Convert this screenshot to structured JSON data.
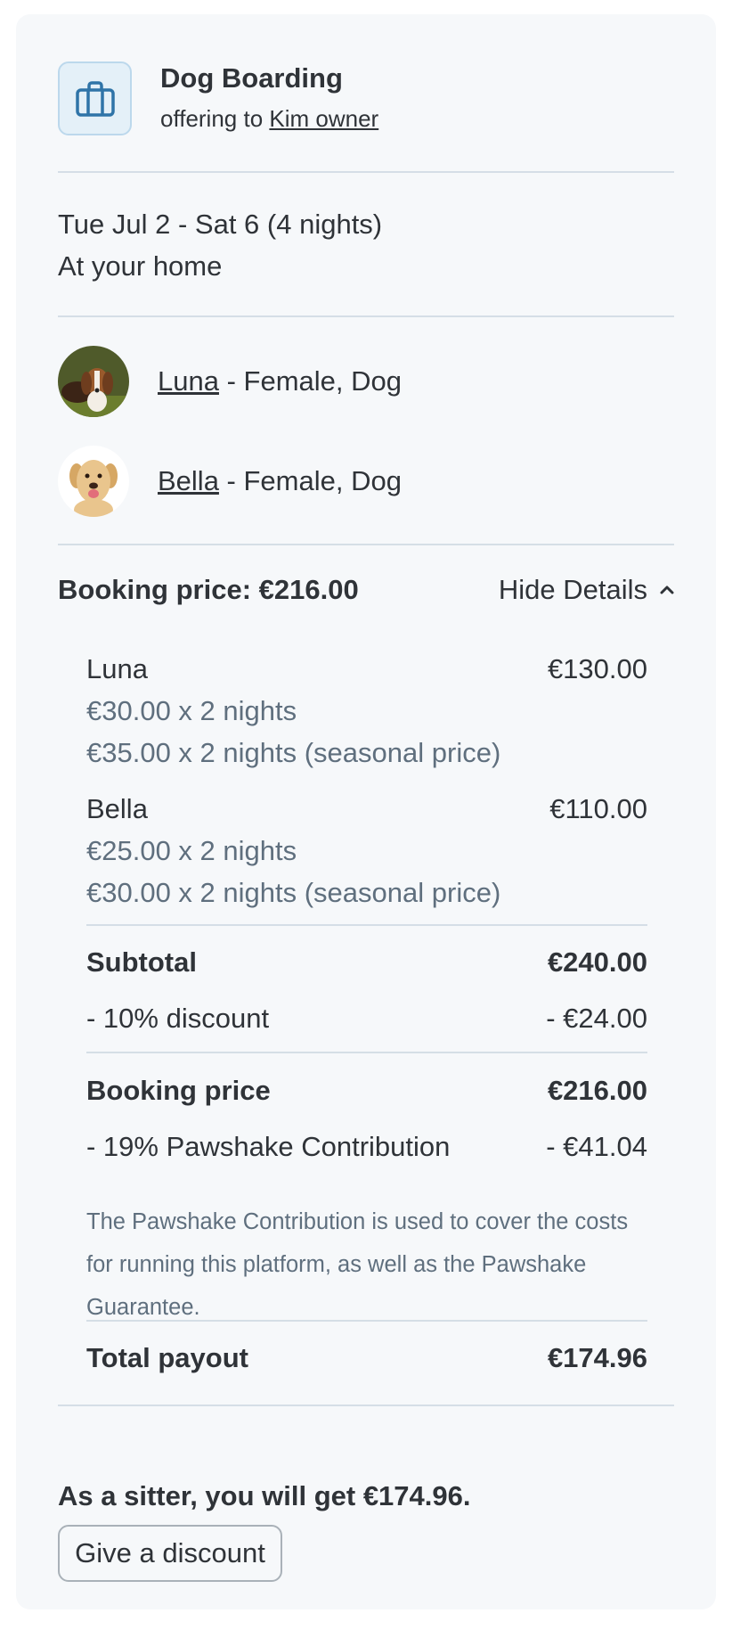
{
  "service": {
    "title": "Dog Boarding",
    "offering_prefix": "offering to ",
    "owner_name": "Kim owner",
    "icon": "briefcase-icon"
  },
  "stay": {
    "dates": "Tue Jul 2 - Sat 6 (4 nights)",
    "location": "At your home"
  },
  "pets": [
    {
      "name": "Luna",
      "details": " - Female, Dog"
    },
    {
      "name": "Bella",
      "details": " - Female, Dog"
    }
  ],
  "price": {
    "heading": "Booking price: €216.00",
    "toggle_label": "Hide Details",
    "breakdown": [
      {
        "pet": "Luna",
        "amount": "€130.00",
        "lines": [
          "€30.00 x 2 nights",
          "€35.00 x 2 nights (seasonal price)"
        ]
      },
      {
        "pet": "Bella",
        "amount": "€110.00",
        "lines": [
          "€25.00 x 2 nights",
          "€30.00 x 2 nights (seasonal price)"
        ]
      }
    ],
    "subtotal_label": "Subtotal",
    "subtotal_value": "€240.00",
    "discount_label": "- 10% discount",
    "discount_value": "- €24.00",
    "booking_label": "Booking price",
    "booking_value": "€216.00",
    "contribution_label": "- 19% Pawshake Contribution",
    "contribution_value": "- €41.04",
    "contribution_note": "The Pawshake Contribution is used to cover the costs for running this platform, as well as the Pawshake Guarantee.",
    "total_label": "Total payout",
    "total_value": "€174.96"
  },
  "summary": "As a sitter, you will get €174.96.",
  "discount_button": "Give a discount"
}
